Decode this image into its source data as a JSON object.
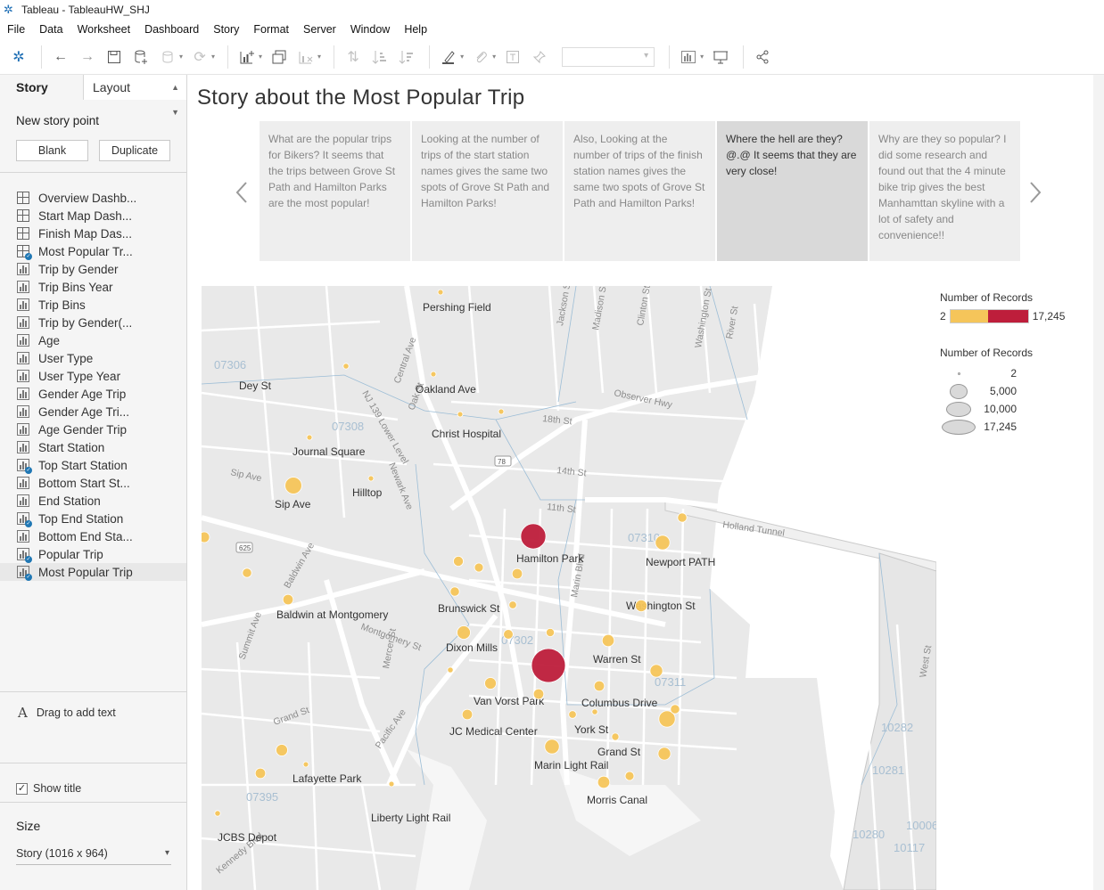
{
  "window": {
    "title": "Tableau - TableauHW_SHJ"
  },
  "menu": [
    "File",
    "Data",
    "Worksheet",
    "Dashboard",
    "Story",
    "Format",
    "Server",
    "Window",
    "Help"
  ],
  "toolbar": {
    "icons": [
      "tableau-logo-icon",
      "back-icon",
      "forward-icon",
      "save-icon",
      "new-datasource-icon",
      "datasource-icon",
      "refresh-icon",
      "new-worksheet-icon",
      "duplicate-icon",
      "clear-icon",
      "swap-icon",
      "sort-asc-icon",
      "sort-desc-icon",
      "highlight-icon",
      "attach-icon",
      "text-icon",
      "pin-icon",
      "fit-dropdown",
      "show-me-icon",
      "presentation-icon",
      "share-icon"
    ]
  },
  "sidebar": {
    "tab_story": "Story",
    "tab_layout": "Layout",
    "new_story_point": "New story point",
    "blank_button": "Blank",
    "duplicate_button": "Duplicate",
    "sheets": [
      {
        "label": "Overview Dashb...",
        "icon": "dashboard-icon",
        "used": false
      },
      {
        "label": "Start Map Dash...",
        "icon": "dashboard-icon",
        "used": false
      },
      {
        "label": "Finish Map Das...",
        "icon": "dashboard-icon",
        "used": false
      },
      {
        "label": "Most Popular Tr...",
        "icon": "dashboard-icon",
        "used": true
      },
      {
        "label": "Trip by Gender",
        "icon": "worksheet-icon",
        "used": false
      },
      {
        "label": "Trip Bins Year",
        "icon": "worksheet-icon",
        "used": false
      },
      {
        "label": "Trip Bins",
        "icon": "worksheet-icon",
        "used": false
      },
      {
        "label": "Trip by Gender(...",
        "icon": "worksheet-icon",
        "used": false
      },
      {
        "label": "Age",
        "icon": "worksheet-icon",
        "used": false
      },
      {
        "label": "User Type",
        "icon": "worksheet-icon",
        "used": false
      },
      {
        "label": "User Type Year",
        "icon": "worksheet-icon",
        "used": false
      },
      {
        "label": "Gender Age Trip",
        "icon": "worksheet-icon",
        "used": false
      },
      {
        "label": "Gender Age Tri...",
        "icon": "worksheet-icon",
        "used": false
      },
      {
        "label": "Age Gender Trip",
        "icon": "worksheet-icon",
        "used": false
      },
      {
        "label": "Start Station",
        "icon": "worksheet-icon",
        "used": false
      },
      {
        "label": "Top Start Station",
        "icon": "worksheet-icon",
        "used": true
      },
      {
        "label": "Bottom Start St...",
        "icon": "worksheet-icon",
        "used": false
      },
      {
        "label": "End Station",
        "icon": "worksheet-icon",
        "used": false
      },
      {
        "label": "Top End Station",
        "icon": "worksheet-icon",
        "used": true
      },
      {
        "label": "Bottom End Sta...",
        "icon": "worksheet-icon",
        "used": false
      },
      {
        "label": "Popular Trip",
        "icon": "worksheet-icon",
        "used": true
      },
      {
        "label": "Most Popular Trip",
        "icon": "worksheet-icon",
        "used": true,
        "selected": true
      }
    ],
    "drag_text": "Drag to add text",
    "show_title": "Show title",
    "size_label": "Size",
    "size_value": "Story (1016 x 964)"
  },
  "story": {
    "title": "Story about the Most Popular Trip",
    "points": [
      {
        "text": "What are the popular trips for Bikers? It seems that the trips between Grove St Path and Hamilton Parks are the most popular!",
        "active": false
      },
      {
        "text": "Looking at the number of trips of the start station names gives the same two spots of Grove St Path and Hamilton Parks!",
        "active": false
      },
      {
        "text": "Also, Looking at the number of trips of the finish station names gives the same two spots of Grove St Path and Hamilton Parks!",
        "active": false
      },
      {
        "text": "Where the hell are they? @.@  It seems that they are very close!",
        "active": true
      },
      {
        "text": "Why are they so popular? I did some research and found out that the 4 minute bike trip gives the best Manhamttan skyline with a lot of safety and convenience!!",
        "active": false
      }
    ]
  },
  "map": {
    "place_labels": [
      "Pershing Field",
      "Oakland Ave",
      "Christ Hospital",
      "Journal Square",
      "Dey St",
      "Hilltop",
      "Sip Ave",
      "Hamilton Park",
      "Newport PATH",
      "Washington St",
      "Brunswick St",
      "Baldwin at Montgomery",
      "Dixon Mills",
      "Warren St",
      "Van Vorst Park",
      "Columbus Drive",
      "JC Medical Center",
      "York St",
      "Grand St",
      "Marin Light Rail",
      "Lafayette Park",
      "Morris Canal",
      "Liberty Light Rail",
      "JCBS Depot"
    ],
    "street_labels": [
      "Observer Hwy",
      "18th St",
      "14th St",
      "11th St",
      "Holland Tunnel",
      "Jackson St",
      "Madison St",
      "Clinton St",
      "Washington St",
      "River St",
      "Sip Ave",
      "Newark Ave",
      "NJ 139 Lower Level",
      "Central Ave",
      "Oak St",
      "Marin Blvd",
      "Grand St",
      "Pacific Ave",
      "Summit Ave",
      "Baldwin Ave",
      "Montgomery St",
      "Mercer St",
      "West St",
      "Kennedy Blvd"
    ],
    "zip_labels": [
      "07306",
      "07308",
      "07302",
      "07310",
      "07311",
      "07395",
      "10282",
      "10281",
      "10280",
      "10117",
      "10006"
    ],
    "road_badges": [
      "78",
      "625"
    ],
    "stations": [
      {
        "records": 300,
        "color": "#f5c55a"
      },
      {
        "records": 350,
        "color": "#f5c55a"
      },
      {
        "records": 300,
        "color": "#f5c55a"
      },
      {
        "records": 200,
        "color": "#f5c55a"
      },
      {
        "records": 500,
        "color": "#f5c55a"
      },
      {
        "records": 150,
        "color": "#f5c55a"
      },
      {
        "records": 4200,
        "color": "#f5c55a"
      },
      {
        "records": 400,
        "color": "#f5c55a"
      },
      {
        "records": 9500,
        "color": "#be1e3b"
      },
      {
        "records": 1300,
        "color": "#f5c55a"
      },
      {
        "records": 3200,
        "color": "#f5c55a"
      },
      {
        "records": 1500,
        "color": "#f5c55a"
      },
      {
        "records": 1200,
        "color": "#f5c55a"
      },
      {
        "records": 1600,
        "color": "#f5c55a"
      },
      {
        "records": 1700,
        "color": "#f5c55a"
      },
      {
        "records": 1300,
        "color": "#f5c55a"
      },
      {
        "records": 1600,
        "color": "#f5c55a"
      },
      {
        "records": 1300,
        "color": "#f5c55a"
      },
      {
        "records": 900,
        "color": "#f5c55a"
      },
      {
        "records": 2700,
        "color": "#f5c55a"
      },
      {
        "records": 1400,
        "color": "#f5c55a"
      },
      {
        "records": 1000,
        "color": "#f5c55a"
      },
      {
        "records": 2200,
        "color": "#f5c55a"
      },
      {
        "records": 2100,
        "color": "#f5c55a"
      },
      {
        "records": 17245,
        "color": "#be1e3b"
      },
      {
        "records": 500,
        "color": "#f5c55a"
      },
      {
        "records": 2000,
        "color": "#f5c55a"
      },
      {
        "records": 1600,
        "color": "#f5c55a"
      },
      {
        "records": 1600,
        "color": "#f5c55a"
      },
      {
        "records": 2400,
        "color": "#f5c55a"
      },
      {
        "records": 900,
        "color": "#f5c55a"
      },
      {
        "records": 1600,
        "color": "#f5c55a"
      },
      {
        "records": 500,
        "color": "#f5c55a"
      },
      {
        "records": 800,
        "color": "#f5c55a"
      },
      {
        "records": 3200,
        "color": "#f5c55a"
      },
      {
        "records": 1200,
        "color": "#f5c55a"
      },
      {
        "records": 2200,
        "color": "#f5c55a"
      },
      {
        "records": 4000,
        "color": "#f5c55a"
      },
      {
        "records": 1300,
        "color": "#f5c55a"
      },
      {
        "records": 2400,
        "color": "#f5c55a"
      },
      {
        "records": 2000,
        "color": "#f5c55a"
      },
      {
        "records": 500,
        "color": "#f5c55a"
      },
      {
        "records": 1600,
        "color": "#f5c55a"
      },
      {
        "records": 200,
        "color": "#f5c55a"
      },
      {
        "records": 100,
        "color": "#f5c55a"
      },
      {
        "records": 100,
        "color": "#f5c55a"
      }
    ]
  },
  "legend": {
    "color_title": "Number of Records",
    "color_min": "2",
    "color_max": "17,245",
    "color_low": "#f5c55a",
    "color_high": "#be1e3b",
    "size_title": "Number of Records",
    "size_items": [
      {
        "label": "2",
        "value": 2
      },
      {
        "label": "5,000",
        "value": 5000
      },
      {
        "label": "10,000",
        "value": 10000
      },
      {
        "label": "17,245",
        "value": 17245
      }
    ]
  }
}
